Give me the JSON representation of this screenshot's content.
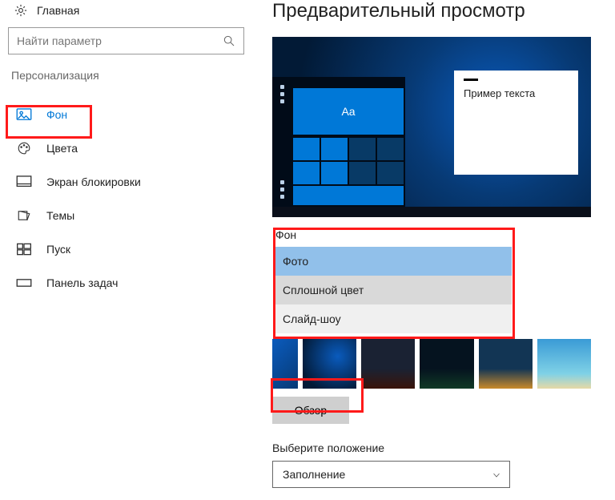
{
  "home_label": "Главная",
  "search": {
    "placeholder": "Найти параметр"
  },
  "section": "Персонализация",
  "nav": [
    {
      "label": "Фон"
    },
    {
      "label": "Цвета"
    },
    {
      "label": "Экран блокировки"
    },
    {
      "label": "Темы"
    },
    {
      "label": "Пуск"
    },
    {
      "label": "Панель задач"
    }
  ],
  "preview": {
    "title": "Предварительный просмотр",
    "tile_text": "Aa",
    "note_text": "Пример текста"
  },
  "background": {
    "label": "Фон",
    "options": [
      "Фото",
      "Сплошной цвет",
      "Слайд-шоу"
    ]
  },
  "browse_label": "Обзор",
  "position": {
    "label": "Выберите положение",
    "value": "Заполнение"
  }
}
